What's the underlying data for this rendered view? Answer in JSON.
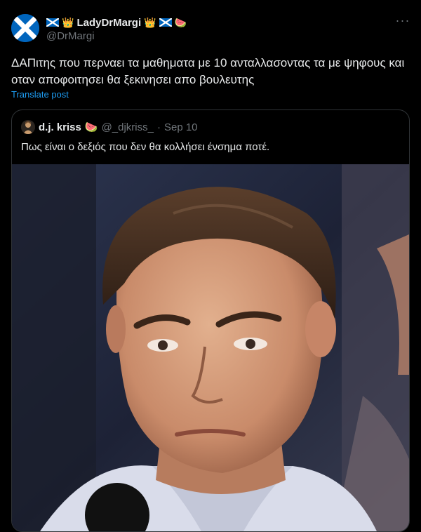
{
  "post": {
    "display_name": "LadyDrMargi",
    "handle": "@DrMargi",
    "text": "ΔΑΠιτης που περναει τα μαθηματα με 10 ανταλλασοντας τα με ψηφους και οταν αποφοιτησει θα ξεκινησει απο βουλευτης",
    "translate_label": "Translate post",
    "more_label": "···"
  },
  "quoted": {
    "display_name": "d.j. kriss",
    "handle": "@_djkriss_",
    "separator": "·",
    "date": "Sep 10",
    "text": "Πως είναι ο δεξιός που δεν θα κολλήσει ένσημα ποτέ."
  },
  "emoji": {
    "crown": "👑",
    "watermelon": "🍉"
  },
  "colors": {
    "background": "#000000",
    "text": "#e7e9ea",
    "muted": "#71767b",
    "link": "#1d9bf0",
    "border": "#2f3336"
  },
  "icons": [
    "scotland-flag-icon",
    "crown-icon",
    "watermelon-icon",
    "more-options-icon"
  ]
}
